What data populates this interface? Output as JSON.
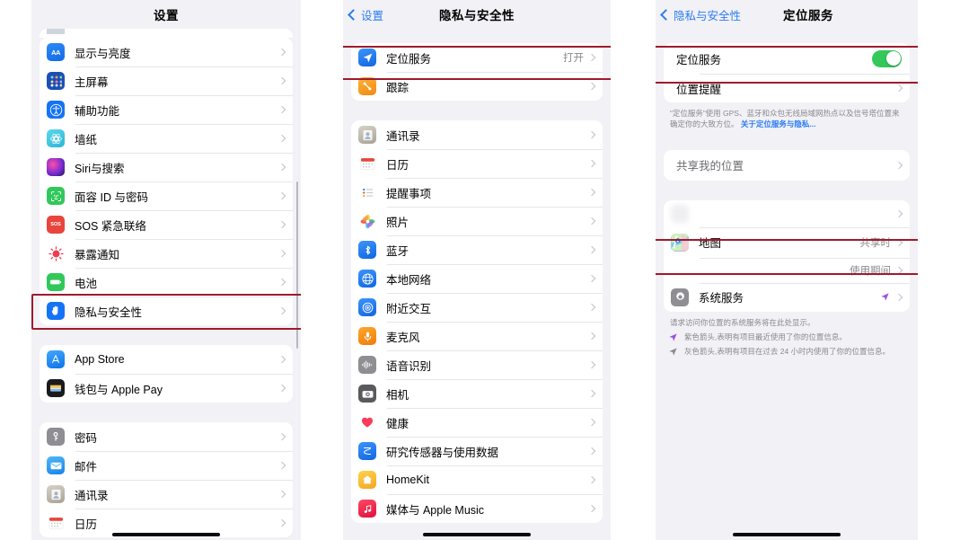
{
  "highlight_color": "#9e1b2c",
  "accent_blue": "#2b7cf2",
  "toggle_on_color": "#34c759",
  "panel1": {
    "nav": {
      "title": "设置"
    },
    "groups": [
      {
        "rows": [
          {
            "label": "显示与亮度",
            "icon": "display-brightness-icon",
            "icon_class": "i-aa",
            "value": ""
          },
          {
            "label": "主屏幕",
            "icon": "home-screen-icon",
            "icon_class": "i-home",
            "value": ""
          },
          {
            "label": "辅助功能",
            "icon": "accessibility-icon",
            "icon_class": "i-access",
            "value": ""
          },
          {
            "label": "墙纸",
            "icon": "wallpaper-icon",
            "icon_class": "i-wall",
            "value": ""
          },
          {
            "label": "Siri与搜索",
            "icon": "siri-icon",
            "icon_class": "i-siri",
            "value": ""
          },
          {
            "label": "面容 ID 与密码",
            "icon": "face-id-icon",
            "icon_class": "i-faceid",
            "value": ""
          },
          {
            "label": "SOS 紧急联络",
            "icon": "sos-icon",
            "icon_class": "i-sos",
            "value": ""
          },
          {
            "label": "暴露通知",
            "icon": "exposure-notification-icon",
            "icon_class": "i-expo",
            "value": ""
          },
          {
            "label": "电池",
            "icon": "battery-icon",
            "icon_class": "i-batt",
            "value": ""
          },
          {
            "label": "隐私与安全性",
            "icon": "privacy-security-icon",
            "icon_class": "i-priv",
            "value": ""
          }
        ]
      },
      {
        "rows": [
          {
            "label": "App Store",
            "icon": "app-store-icon",
            "icon_class": "i-appstore",
            "value": ""
          },
          {
            "label": "钱包与 Apple Pay",
            "icon": "wallet-icon",
            "icon_class": "i-wallet",
            "value": ""
          }
        ]
      },
      {
        "rows": [
          {
            "label": "密码",
            "icon": "passwords-icon",
            "icon_class": "i-pass",
            "value": ""
          },
          {
            "label": "邮件",
            "icon": "mail-icon",
            "icon_class": "i-mail",
            "value": ""
          },
          {
            "label": "通讯录",
            "icon": "contacts-icon",
            "icon_class": "i-contacts",
            "value": ""
          },
          {
            "label": "日历",
            "icon": "calendar-icon",
            "icon_class": "i-cal",
            "value": ""
          }
        ]
      }
    ]
  },
  "panel2": {
    "nav": {
      "back": "设置",
      "title": "隐私与安全性"
    },
    "groups": [
      {
        "rows": [
          {
            "label": "定位服务",
            "icon": "location-services-icon",
            "icon_class": "i-loc",
            "value": "打开"
          },
          {
            "label": "跟踪",
            "icon": "tracking-icon",
            "icon_class": "i-track",
            "value": ""
          }
        ]
      },
      {
        "rows": [
          {
            "label": "通讯录",
            "icon": "contacts-icon",
            "icon_class": "i-contacts",
            "value": ""
          },
          {
            "label": "日历",
            "icon": "calendar-icon",
            "icon_class": "i-cal",
            "value": ""
          },
          {
            "label": "提醒事项",
            "icon": "reminders-icon",
            "icon_class": "i-remind",
            "value": ""
          },
          {
            "label": "照片",
            "icon": "photos-icon",
            "icon_class": "i-photos",
            "value": ""
          },
          {
            "label": "蓝牙",
            "icon": "bluetooth-icon",
            "icon_class": "i-bt",
            "value": ""
          },
          {
            "label": "本地网络",
            "icon": "local-network-icon",
            "icon_class": "i-net",
            "value": ""
          },
          {
            "label": "附近交互",
            "icon": "nearby-interactions-icon",
            "icon_class": "i-near",
            "value": ""
          },
          {
            "label": "麦克风",
            "icon": "microphone-icon",
            "icon_class": "i-mic",
            "value": ""
          },
          {
            "label": "语音识别",
            "icon": "speech-recognition-icon",
            "icon_class": "i-speech",
            "value": ""
          },
          {
            "label": "相机",
            "icon": "camera-icon",
            "icon_class": "i-cam",
            "value": ""
          },
          {
            "label": "健康",
            "icon": "health-icon",
            "icon_class": "i-health",
            "value": ""
          },
          {
            "label": "研究传感器与使用数据",
            "icon": "research-sensor-icon",
            "icon_class": "i-research",
            "value": ""
          },
          {
            "label": "HomeKit",
            "icon": "homekit-icon",
            "icon_class": "i-homekit",
            "value": ""
          },
          {
            "label": "媒体与 Apple Music",
            "icon": "apple-music-icon",
            "icon_class": "i-music",
            "value": ""
          }
        ]
      }
    ]
  },
  "panel3": {
    "nav": {
      "back": "隐私与安全性",
      "title": "定位服务"
    },
    "toggle_row": {
      "label": "定位服务",
      "state": "on"
    },
    "alerts_row": {
      "label": "位置提醒"
    },
    "note": {
      "text": "“定位服务”使用 GPS、蓝牙和众包无线局域网热点以及信号塔位置来确定你的大致方位。",
      "link": "关于定位服务与隐私..."
    },
    "share_row": {
      "label": "共享我的位置"
    },
    "apps": [
      {
        "label": "",
        "value": "",
        "icon": "redacted-app-icon",
        "icon_class": "",
        "redacted": true
      },
      {
        "label": "地图",
        "value": "共享时",
        "icon": "maps-icon",
        "icon_class": "i-maps",
        "redacted": false
      },
      {
        "label": "",
        "value": "使用期间",
        "icon": "redacted-app-icon",
        "icon_class": "",
        "redacted": true
      }
    ],
    "system_services_row": {
      "label": "系统服务",
      "arrow": "purple"
    },
    "footer": {
      "intro": "请求访问你位置的系统服务将在此处显示。",
      "legend": [
        {
          "arrow": "purple",
          "text": "紫色箭头,表明有项目最近使用了你的位置信息。"
        },
        {
          "arrow": "gray",
          "text": "灰色箭头,表明有项目在过去 24 小时内使用了你的位置信息。"
        }
      ]
    }
  }
}
